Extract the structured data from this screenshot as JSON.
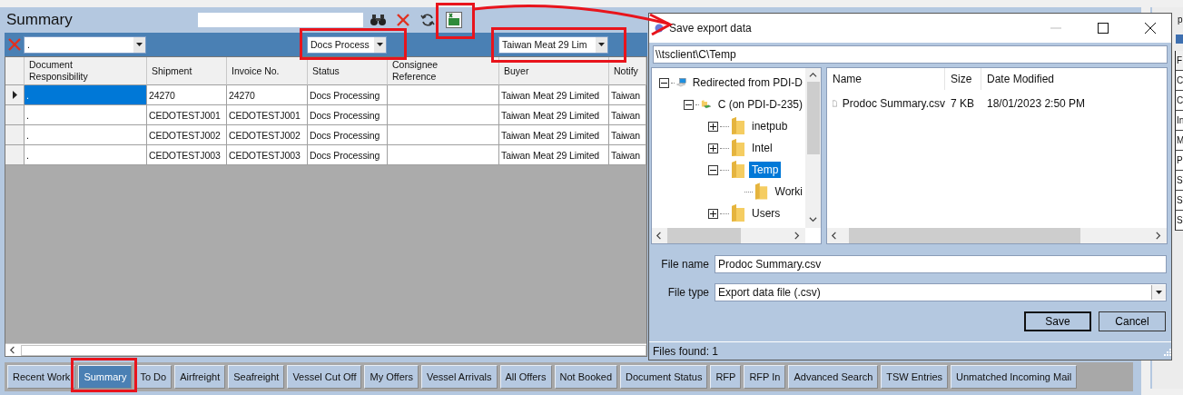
{
  "window": {
    "title": "Summary"
  },
  "filters": [
    {
      "value": "."
    },
    {
      "value": "Docs Process"
    },
    {
      "value": "Taiwan Meat 29 Lim"
    }
  ],
  "table": {
    "columns": [
      "Document Responsibility",
      "Shipment",
      "Invoice No.",
      "Status",
      "Consignee Reference",
      "Buyer",
      "Notify"
    ],
    "rows": [
      {
        "selected": true,
        "document_responsibility": ".",
        "shipment": "24270",
        "invoice_no": "24270",
        "status": "Docs Processing",
        "buyer": "Taiwan Meat 29 Limited",
        "notify": "Taiwan"
      },
      {
        "selected": false,
        "document_responsibility": ".",
        "shipment": "CEDOTESTJ001",
        "invoice_no": "CEDOTESTJ001",
        "status": "Docs Processing",
        "buyer": "Taiwan Meat 29 Limited",
        "notify": "Taiwan"
      },
      {
        "selected": false,
        "document_responsibility": ".",
        "shipment": "CEDOTESTJ002",
        "invoice_no": "CEDOTESTJ002",
        "status": "Docs Processing",
        "buyer": "Taiwan Meat 29 Limited",
        "notify": "Taiwan"
      },
      {
        "selected": false,
        "document_responsibility": ".",
        "shipment": "CEDOTESTJ003",
        "invoice_no": "CEDOTESTJ003",
        "status": "Docs Processing",
        "buyer": "Taiwan Meat 29 Limited",
        "notify": "Taiwan"
      }
    ]
  },
  "tabs": [
    {
      "label": "Recent Work",
      "selected": false
    },
    {
      "label": "Summary",
      "selected": true
    },
    {
      "label": "To Do",
      "selected": false
    },
    {
      "label": "Airfreight",
      "selected": false
    },
    {
      "label": "Seafreight",
      "selected": false
    },
    {
      "label": "Vessel Cut Off",
      "selected": false
    },
    {
      "label": "My Offers",
      "selected": false
    },
    {
      "label": "Vessel Arrivals",
      "selected": false
    },
    {
      "label": "All Offers",
      "selected": false
    },
    {
      "label": "Not Booked",
      "selected": false
    },
    {
      "label": "Document Status",
      "selected": false
    },
    {
      "label": "RFP",
      "selected": false
    },
    {
      "label": "RFP In",
      "selected": false
    },
    {
      "label": "Advanced Search",
      "selected": false
    },
    {
      "label": "TSW Entries",
      "selected": false
    },
    {
      "label": "Unmatched Incoming Mail",
      "selected": false
    }
  ],
  "dialog": {
    "title": "Save export data",
    "path": "\\\\tsclient\\C\\Temp",
    "tree": [
      {
        "label": "Redirected from PDI-D",
        "kind": "computer",
        "expanded": true,
        "selected": false,
        "children": [
          {
            "label": "C (on PDI-D-235)",
            "kind": "drive",
            "expanded": true,
            "selected": false,
            "children": [
              {
                "label": "inetpub",
                "kind": "folder",
                "expanded": false,
                "selected": false
              },
              {
                "label": "Intel",
                "kind": "folder",
                "expanded": false,
                "selected": false
              },
              {
                "label": "Temp",
                "kind": "folder",
                "expanded": true,
                "selected": true,
                "children": [
                  {
                    "label": "Worki",
                    "kind": "folder",
                    "selected": false
                  }
                ]
              },
              {
                "label": "Users",
                "kind": "folder",
                "expanded": false,
                "selected": false
              }
            ]
          }
        ]
      }
    ],
    "file_columns": [
      "Name",
      "Size",
      "Date Modified"
    ],
    "files": [
      {
        "name": "Prodoc Summary.csv",
        "size": "7 KB",
        "date_modified": "18/01/2023 2:50 PM"
      }
    ],
    "file_name": {
      "label": "File name",
      "value": "Prodoc Summary.csv"
    },
    "file_type": {
      "label": "File type",
      "value": "Export data file (.csv)"
    },
    "buttons": [
      {
        "label": "Save",
        "default": true
      },
      {
        "label": "Cancel",
        "default": false
      }
    ],
    "status": "Files found: 1"
  },
  "right_panel": {
    "title": "p",
    "header": "F",
    "items": [
      "C",
      "C",
      "In",
      "M",
      "P",
      "S",
      "S",
      "S"
    ]
  }
}
